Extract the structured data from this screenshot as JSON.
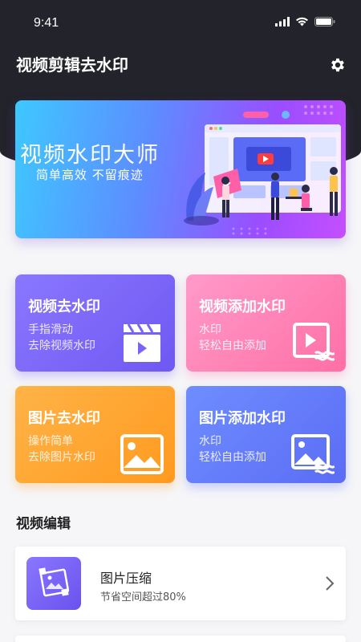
{
  "status_bar": {
    "time": "9:41"
  },
  "header": {
    "title": "视频剪辑去水印"
  },
  "banner": {
    "title": "视频水印大师",
    "subtitle": "简单高效  不留痕迹"
  },
  "cards": [
    {
      "title": "视频去水印",
      "line1": "手指滑动",
      "line2": "去除视频水印",
      "icon": "clapperboard-icon"
    },
    {
      "title": "视频添加水印",
      "line1": "水印",
      "line2": "轻松自由添加",
      "icon": "video-watermark-icon"
    },
    {
      "title": "图片去水印",
      "line1": "操作简单",
      "line2": "去除图片水印",
      "icon": "image-icon"
    },
    {
      "title": "图片添加水印",
      "line1": "水印",
      "line2": "轻松自由添加",
      "icon": "image-watermark-icon"
    }
  ],
  "section": {
    "title": "视频编辑"
  },
  "list": [
    {
      "title": "图片压缩",
      "subtitle": "节省空间超过80%"
    }
  ],
  "colors": {
    "header_bg": "#23232b",
    "card_purple": "#7a64f6",
    "card_pink": "#ff7fb2",
    "card_orange": "#ffa633",
    "card_blue": "#6578f8"
  }
}
